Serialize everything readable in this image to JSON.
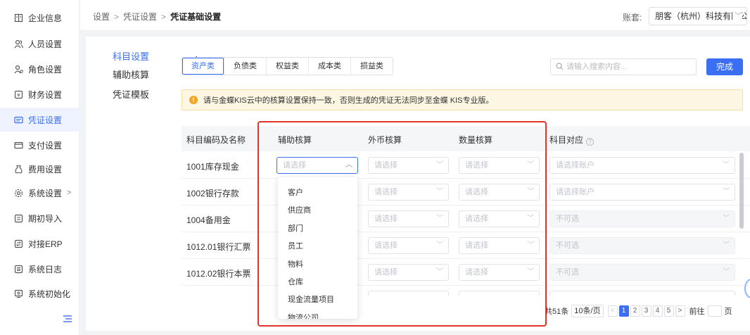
{
  "sidebar": {
    "items": [
      {
        "label": "企业信息",
        "icon": "building-icon"
      },
      {
        "label": "人员设置",
        "icon": "users-icon"
      },
      {
        "label": "角色设置",
        "icon": "role-icon"
      },
      {
        "label": "财务设置",
        "icon": "finance-icon"
      },
      {
        "label": "凭证设置",
        "icon": "voucher-icon",
        "active": true
      },
      {
        "label": "支付设置",
        "icon": "payment-icon"
      },
      {
        "label": "费用设置",
        "icon": "expense-icon"
      },
      {
        "label": "系统设置",
        "icon": "system-icon",
        "arrow": ">"
      },
      {
        "label": "期初导入",
        "icon": "import-icon"
      },
      {
        "label": "对接ERP",
        "icon": "erp-icon"
      },
      {
        "label": "系统日志",
        "icon": "log-icon"
      },
      {
        "label": "系统初始化",
        "icon": "init-icon"
      }
    ]
  },
  "header": {
    "breadcrumb": [
      "设置",
      "凭证设置",
      "凭证基础设置"
    ],
    "separator": ">",
    "account_label": "账套:",
    "account_value": "朋客（杭州）科技有限公司"
  },
  "subnav": {
    "items": [
      "科目设置",
      "辅助核算",
      "凭证模板"
    ],
    "active": "科目设置"
  },
  "tabs": [
    "资产类",
    "负债类",
    "权益类",
    "成本类",
    "损益类"
  ],
  "active_tab": "资产类",
  "search": {
    "placeholder": "请输入搜索内容..."
  },
  "done_label": "完成",
  "warning": "请与金蝶KIS云中的核算设置保持一致，否则生成的凭证无法同步至金蝶 KIS专业版。",
  "table": {
    "headers": [
      "科目编码及名称",
      "辅助核算",
      "外币核算",
      "数量核算",
      "科目对应"
    ],
    "select_placeholder": "请选择",
    "account_placeholder": "请选择账户",
    "not_selectable": "不可选",
    "rows": [
      {
        "name": "1001库存现金",
        "mapping": "请选择账户"
      },
      {
        "name": "1002银行存款",
        "mapping": "请选择账户"
      },
      {
        "name": "1004备用金",
        "mapping": "不可选"
      },
      {
        "name": "1012.01银行汇票",
        "mapping": "不可选"
      },
      {
        "name": "1012.02银行本票",
        "mapping": "不可选"
      }
    ]
  },
  "dropdown_options": [
    "客户",
    "供应商",
    "部门",
    "员工",
    "物料",
    "仓库",
    "现金流量项目",
    "物流公司"
  ],
  "pagination": {
    "total": "共51条",
    "page_size": "10条/页",
    "pages": [
      "1",
      "2",
      "3",
      "4",
      "5"
    ],
    "current": "1",
    "goto": "前往",
    "unit": "页"
  },
  "colors": {
    "accent": "#3a6ff3",
    "highlight": "#e0332a",
    "warning_bg": "#fdf6e3"
  }
}
